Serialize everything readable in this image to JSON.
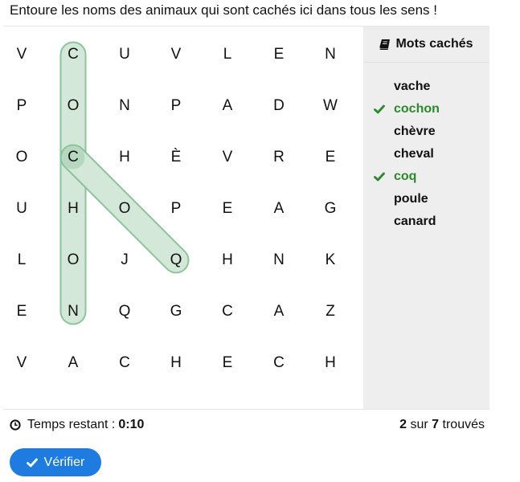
{
  "instruction": "Entoure les noms des animaux qui sont cachés ici dans tous les sens !",
  "grid": [
    [
      "V",
      "C",
      "U",
      "V",
      "L",
      "E",
      "N"
    ],
    [
      "P",
      "O",
      "N",
      "P",
      "A",
      "D",
      "W"
    ],
    [
      "O",
      "C",
      "H",
      "È",
      "V",
      "R",
      "E"
    ],
    [
      "U",
      "H",
      "O",
      "P",
      "E",
      "A",
      "G"
    ],
    [
      "L",
      "O",
      "J",
      "Q",
      "H",
      "N",
      "K"
    ],
    [
      "E",
      "N",
      "Q",
      "G",
      "C",
      "A",
      "Z"
    ],
    [
      "V",
      "A",
      "C",
      "H",
      "E",
      "C",
      "H"
    ]
  ],
  "highlights": [
    {
      "word": "cochon",
      "start": [
        0,
        1
      ],
      "end": [
        5,
        1
      ]
    },
    {
      "word": "coq",
      "start": [
        2,
        1
      ],
      "end": [
        4,
        3
      ]
    }
  ],
  "highlight_color": "#7fbf8f",
  "sidebar": {
    "title": "Mots cachés",
    "icon": "book-icon",
    "words": [
      {
        "label": "vache",
        "found": false
      },
      {
        "label": "cochon",
        "found": true
      },
      {
        "label": "chèvre",
        "found": false
      },
      {
        "label": "cheval",
        "found": false
      },
      {
        "label": "coq",
        "found": true
      },
      {
        "label": "poule",
        "found": false
      },
      {
        "label": "canard",
        "found": false
      }
    ]
  },
  "footer": {
    "timer_label": "Temps restant :",
    "timer_value": "0:10",
    "found_count": "2",
    "sur": "sur",
    "total_count": "7",
    "trouves": "trouvés"
  },
  "verify_button": {
    "label": "Vérifier",
    "icon": "check-icon"
  },
  "colors": {
    "found": "#2a8a2a",
    "button": "#1e7be0"
  }
}
